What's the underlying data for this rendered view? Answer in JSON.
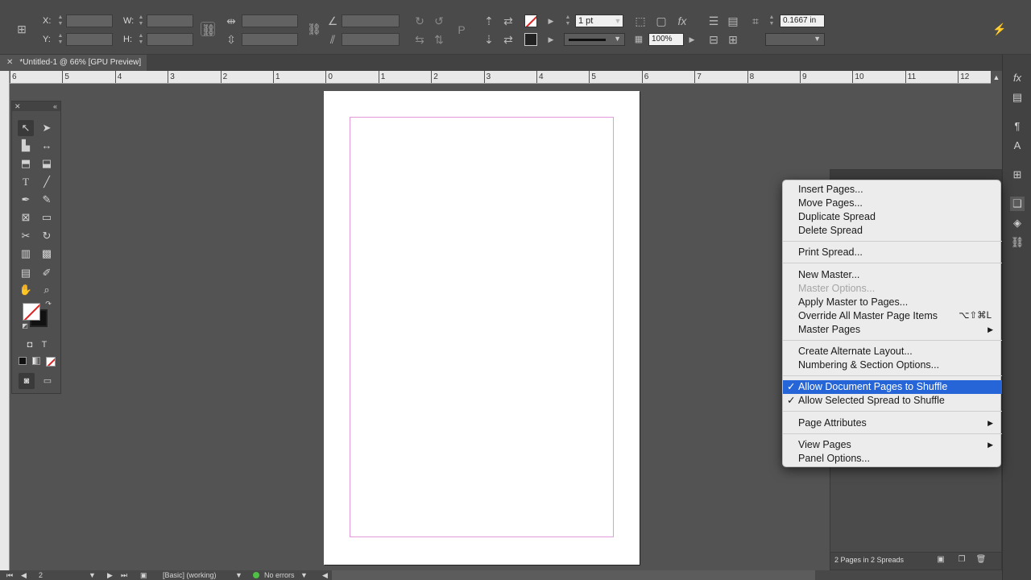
{
  "document_tab": {
    "title": "*Untitled-1 @ 66% [GPU Preview]"
  },
  "control_bar": {
    "x_label": "X:",
    "y_label": "Y:",
    "w_label": "W:",
    "h_label": "H:",
    "stroke_weight": "1 pt",
    "opacity": "100%",
    "inset": "0.1667 in"
  },
  "ruler_ticks": [
    "6",
    "5",
    "4",
    "3",
    "2",
    "1",
    "0",
    "1",
    "2",
    "3",
    "4",
    "5",
    "6",
    "7",
    "8",
    "9",
    "10",
    "11",
    "12"
  ],
  "context_menu": {
    "items": [
      {
        "label": "Insert Pages..."
      },
      {
        "label": "Move Pages..."
      },
      {
        "label": "Duplicate Spread"
      },
      {
        "label": "Delete Spread"
      },
      {
        "label": "Print Spread..."
      },
      {
        "label": "New Master..."
      },
      {
        "label": "Master Options..."
      },
      {
        "label": "Apply Master to Pages..."
      },
      {
        "label": "Override All Master Page Items",
        "shortcut": "⌥⇧⌘L"
      },
      {
        "label": "Master Pages"
      },
      {
        "label": "Create Alternate Layout..."
      },
      {
        "label": "Numbering & Section Options..."
      },
      {
        "label": "Allow Document Pages to Shuffle"
      },
      {
        "label": "Allow Selected Spread to Shuffle"
      },
      {
        "label": "Page Attributes"
      },
      {
        "label": "View Pages"
      },
      {
        "label": "Panel Options..."
      }
    ]
  },
  "pages_panel": {
    "footer": "2 Pages in 2 Spreads"
  },
  "status_bar": {
    "page_number": "2",
    "preflight_profile": "[Basic] (working)",
    "errors": "No errors"
  },
  "colors": {
    "menu_highlight": "#2565d8",
    "margin_guide": "#e39cd9",
    "ok_dot": "#4fc046"
  }
}
